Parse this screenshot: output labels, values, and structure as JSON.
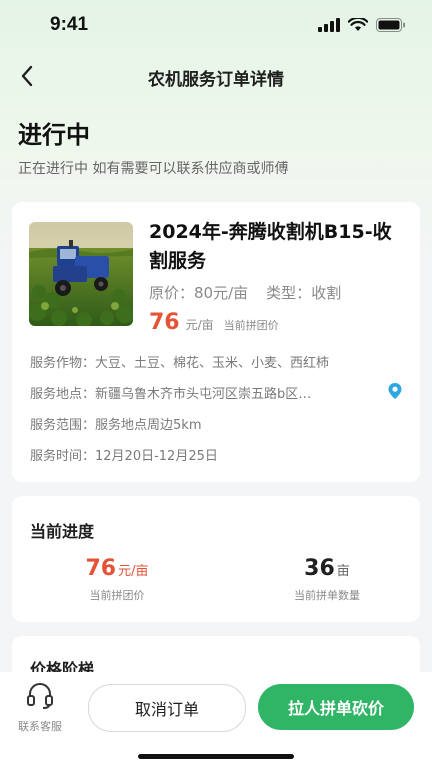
{
  "status_bar": {
    "time": "9:41"
  },
  "nav": {
    "title": "农机服务订单详情"
  },
  "order_status": {
    "heading": "进行中",
    "description": "正在进行中 如有需要可以联系供应商或师傅"
  },
  "service": {
    "title": "2024年-奔腾收割机B15-收割服务",
    "original_price_label": "原价：",
    "original_price": "80元/亩",
    "type_label": "类型：",
    "type": "收割",
    "group_price": "76",
    "group_price_unit": "元/亩",
    "group_price_tag": "当前拼团价",
    "crops_label": "服务作物：",
    "crops": "大豆、土豆、棉花、玉米、小麦、西红柿",
    "location_label": "服务地点：",
    "location": "新疆乌鲁木齐市头屯河区崇五路b区…",
    "range_label": "服务范围：",
    "range": "服务地点周边5km",
    "time_label": "服务时间：",
    "time": "12月20日-12月25日"
  },
  "progress": {
    "title": "当前进度",
    "price_value": "76",
    "price_unit": "元/亩",
    "price_caption": "当前拼团价",
    "count_value": "36",
    "count_unit": "亩",
    "count_caption": "当前拼单数量"
  },
  "ladder": {
    "title": "价格阶梯"
  },
  "bottom": {
    "customer_service": "联系客服",
    "cancel": "取消订单",
    "invite": "拉人拼单砍价"
  },
  "colors": {
    "accent_green": "#2fb565",
    "price_red": "#e55337",
    "location_blue": "#2ea7e0"
  },
  "icons": {
    "back": "chevron-left-icon",
    "location": "location-pin-icon",
    "customer_service": "headset-icon"
  }
}
